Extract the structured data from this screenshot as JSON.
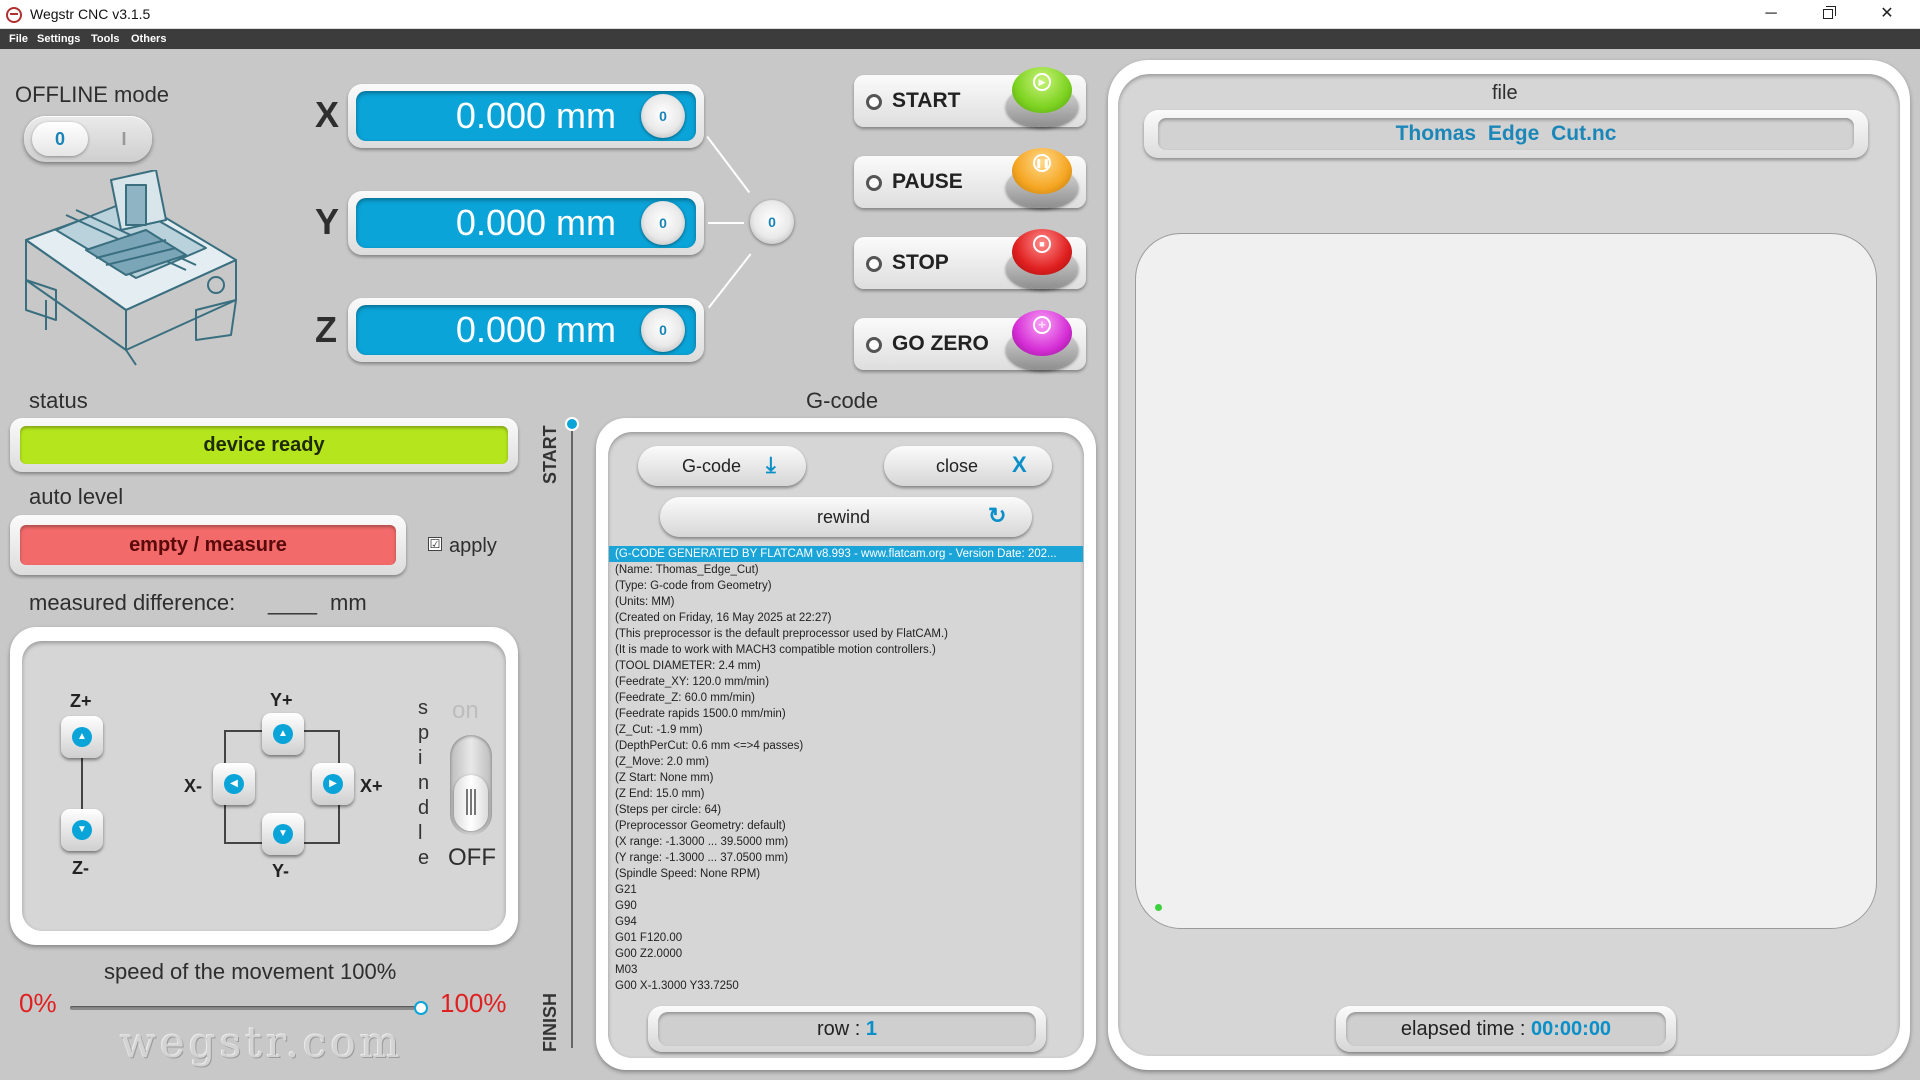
{
  "window": {
    "title": "Wegstr CNC  v3.1.5",
    "minimize": "─",
    "close": "✕"
  },
  "menu": {
    "items": [
      "File",
      "Settings",
      "Tools",
      "Others"
    ]
  },
  "offline": {
    "label": "OFFLINE mode",
    "on": "0",
    "off": "I"
  },
  "axes": [
    {
      "letter": "X",
      "value": "0.000 mm",
      "zero": "0"
    },
    {
      "letter": "Y",
      "value": "0.000 mm",
      "zero": "0"
    },
    {
      "letter": "Z",
      "value": "0.000 mm",
      "zero": "0"
    }
  ],
  "zero_all": "0",
  "controls": {
    "start": {
      "label": "START",
      "color": "#7ed321",
      "icon": "play-icon"
    },
    "pause": {
      "label": "PAUSE",
      "color": "#f5a623",
      "icon": "pause-icon"
    },
    "stop": {
      "label": "STOP",
      "color": "#e02020",
      "icon": "stop-icon"
    },
    "go_zero": {
      "label": "GO ZERO",
      "color": "#d62fd6",
      "icon": "crosshair-icon"
    }
  },
  "status": {
    "label": "status",
    "value": "device ready",
    "color": "#b5e61d"
  },
  "auto_level": {
    "label": "auto level",
    "value": "empty / measure",
    "color": "#f26a6a",
    "apply_label": "apply",
    "apply_checked": "☑"
  },
  "measured": {
    "label": "measured difference:",
    "value": "____",
    "unit": "mm"
  },
  "jog": {
    "z_plus": "Z+",
    "z_minus": "Z-",
    "y_plus": "Y+",
    "y_minus": "Y-",
    "x_plus": "X+",
    "x_minus": "X-",
    "spindle_letters": [
      "s",
      "p",
      "i",
      "n",
      "d",
      "l",
      "e"
    ],
    "spindle_on": "on",
    "spindle_off": "OFF"
  },
  "speed": {
    "label": "speed of the movement 100%",
    "min": "0%",
    "max": "100%",
    "value_percent": 100
  },
  "watermark": "wegstr.com",
  "progress": {
    "start": "START",
    "finish": "FINISH"
  },
  "gcode": {
    "title": "G-code",
    "load_label": "G-code",
    "close_label": "close",
    "close_icon": "X",
    "rewind_label": "rewind",
    "lines": [
      "(G-CODE GENERATED BY FLATCAM v8.993 - www.flatcam.org - Version Date: 202...",
      "(Name: Thomas_Edge_Cut)",
      "(Type: G-code from Geometry)",
      "(Units: MM)",
      "(Created on Friday, 16 May 2025 at 22:27)",
      "(This preprocessor is the default preprocessor used by FlatCAM.)",
      "(It is made to work with MACH3 compatible motion controllers.)",
      "(TOOL DIAMETER: 2.4 mm)",
      "(Feedrate_XY: 120.0 mm/min)",
      "(Feedrate_Z: 60.0 mm/min)",
      "(Feedrate rapids 1500.0 mm/min)",
      "(Z_Cut: -1.9 mm)",
      "(DepthPerCut: 0.6 mm <=>4 passes)",
      "(Z_Move: 2.0 mm)",
      "(Z Start: None mm)",
      "(Z End: 15.0 mm)",
      "(Steps per circle: 64)",
      "(Preprocessor Geometry: default)",
      "(X range:   -1.3000 ...  39.5000  mm)",
      "(Y range:   -1.3000 ...  37.0500  mm)",
      "(Spindle Speed: None RPM)",
      "G21",
      "G90",
      "G94",
      "G01 F120.00",
      "G00 Z2.0000",
      "M03",
      "G00 X-1.3000 Y33.7250"
    ],
    "row_label": "row : ",
    "row_value": "1"
  },
  "file": {
    "label": "file",
    "name": "Thomas  Edge  Cut.nc",
    "elapsed_label": "elapsed time : ",
    "elapsed_value": "00:00:00"
  }
}
